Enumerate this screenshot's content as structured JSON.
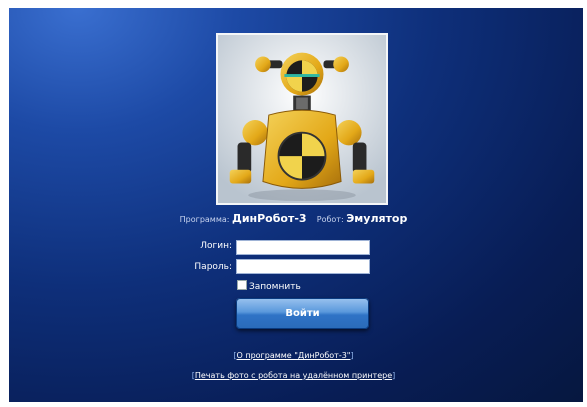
{
  "caption": {
    "program_label": "Программа:",
    "program_value": "ДинРобот-3",
    "robot_label": "Робот:",
    "robot_value": "Эмулятор"
  },
  "form": {
    "login_label": "Логин:",
    "password_label": "Пароль:",
    "login_value": "",
    "password_value": "",
    "remember_label": "Запомнить",
    "submit_label": "Войти"
  },
  "links": {
    "about": "О программе \"ДинРобот-3\"",
    "print": "Печать фото с робота на удалённом принтере"
  },
  "colors": {
    "background": "#0e2f7a",
    "robot_yellow": "#e6b020"
  }
}
